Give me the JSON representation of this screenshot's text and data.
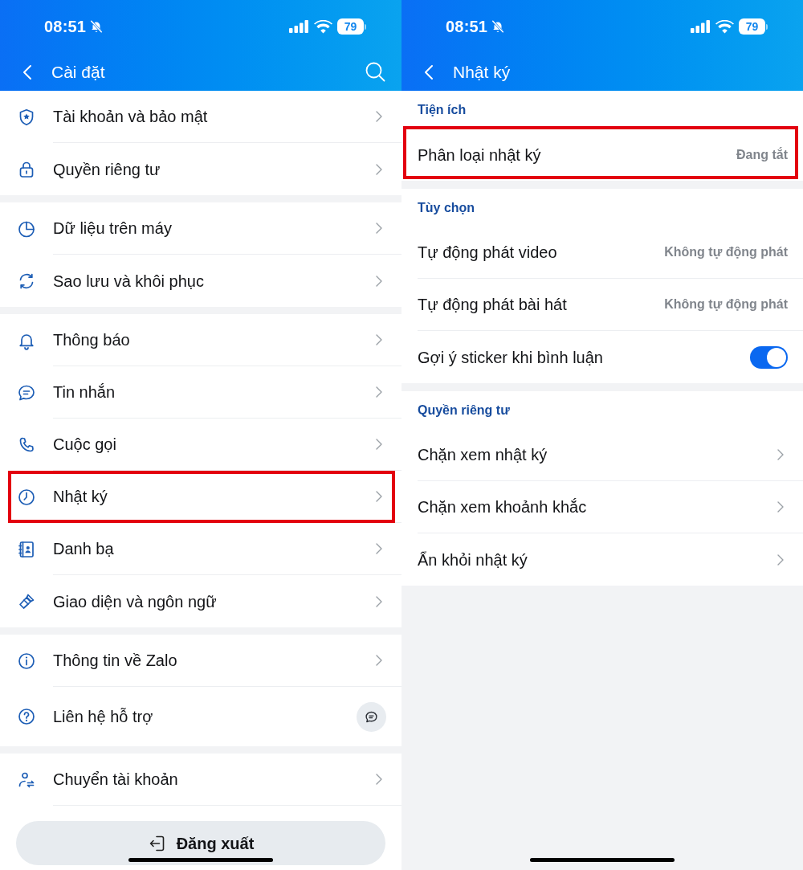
{
  "settings_screen": {
    "status_bar": {
      "time": "08:51",
      "battery": "79"
    },
    "header": {
      "title": "Cài đặt",
      "search": true
    },
    "groups": [
      {
        "items": [
          {
            "kind": "link",
            "label": "Tài khoản và bảo mật",
            "highlighted": false
          },
          {
            "kind": "link",
            "label": "Quyền riêng tư",
            "highlighted": false
          }
        ]
      },
      {
        "items": [
          {
            "kind": "link",
            "label": "Dữ liệu trên máy",
            "highlighted": false
          },
          {
            "kind": "link",
            "label": "Sao lưu và khôi phục",
            "highlighted": false
          }
        ]
      },
      {
        "items": [
          {
            "kind": "link",
            "label": "Thông báo",
            "highlighted": false
          },
          {
            "kind": "link",
            "label": "Tin nhắn",
            "highlighted": false
          },
          {
            "kind": "link",
            "label": "Cuộc gọi",
            "highlighted": false
          },
          {
            "kind": "link",
            "label": "Nhật ký",
            "highlighted": true
          },
          {
            "kind": "link",
            "label": "Danh bạ",
            "highlighted": false
          },
          {
            "kind": "link",
            "label": "Giao diện và ngôn ngữ",
            "highlighted": false
          }
        ]
      },
      {
        "items": [
          {
            "kind": "link",
            "label": "Thông tin về Zalo",
            "highlighted": false
          },
          {
            "kind": "chat",
            "label": "Liên hệ hỗ trợ",
            "highlighted": false
          }
        ]
      },
      {
        "items": [
          {
            "kind": "link",
            "label": "Chuyển tài khoản",
            "highlighted": false
          }
        ]
      }
    ],
    "logout_button": {
      "label": "Đăng xuất"
    }
  },
  "journal_screen": {
    "status_bar": {
      "time": "08:51",
      "battery": "79"
    },
    "header": {
      "title": "Nhật ký"
    },
    "sections": [
      {
        "title": "Tiện ích",
        "items": [
          {
            "kind": "value",
            "label": "Phân loại nhật ký",
            "value": "Đang tắt",
            "highlighted": true
          }
        ]
      },
      {
        "title": "Tùy chọn",
        "items": [
          {
            "kind": "value",
            "label": "Tự động phát video",
            "value": "Không tự động phát",
            "highlighted": false
          },
          {
            "kind": "value",
            "label": "Tự động phát bài hát",
            "value": "Không tự động phát",
            "highlighted": false
          },
          {
            "kind": "toggle",
            "label": "Gợi ý sticker khi bình luận",
            "on": true,
            "highlighted": false
          }
        ]
      },
      {
        "title": "Quyền riêng tư",
        "items": [
          {
            "kind": "link",
            "label": "Chặn xem nhật ký",
            "highlighted": false
          },
          {
            "kind": "link",
            "label": "Chặn xem khoảnh khắc",
            "highlighted": false
          },
          {
            "kind": "link",
            "label": "Ẩn khỏi nhật ký",
            "highlighted": false
          }
        ]
      }
    ]
  }
}
